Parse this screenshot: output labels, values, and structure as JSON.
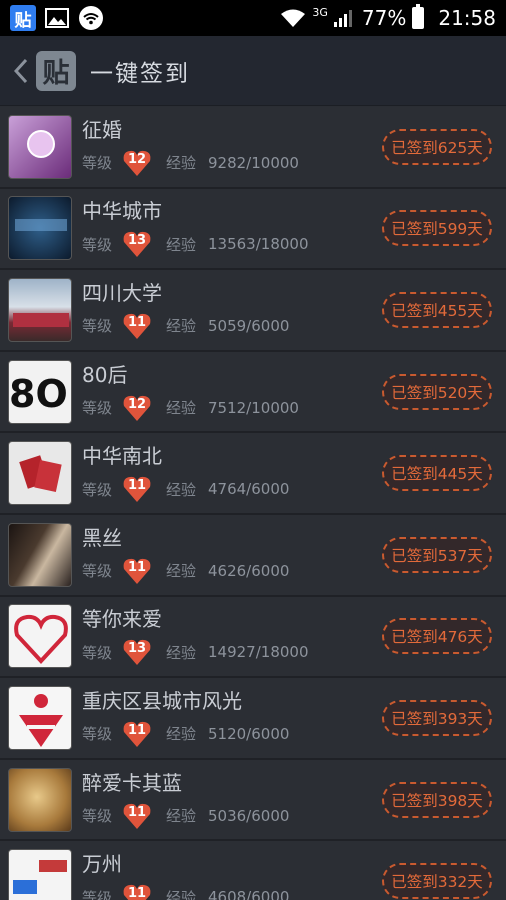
{
  "status_bar": {
    "network": "3G",
    "battery": "77%",
    "time": "21:58"
  },
  "header": {
    "logo_text": "贴",
    "title": "一键签到"
  },
  "labels": {
    "level": "等级",
    "exp": "经验"
  },
  "forums": [
    {
      "name": "征婚",
      "level": "12",
      "exp": "9282/10000",
      "signed": "已签到625天"
    },
    {
      "name": "中华城市",
      "level": "13",
      "exp": "13563/18000",
      "signed": "已签到599天"
    },
    {
      "name": "四川大学",
      "level": "11",
      "exp": "5059/6000",
      "signed": "已签到455天"
    },
    {
      "name": "80后",
      "level": "12",
      "exp": "7512/10000",
      "signed": "已签到520天"
    },
    {
      "name": "中华南北",
      "level": "11",
      "exp": "4764/6000",
      "signed": "已签到445天"
    },
    {
      "name": "黑丝",
      "level": "11",
      "exp": "4626/6000",
      "signed": "已签到537天"
    },
    {
      "name": "等你来爱",
      "level": "13",
      "exp": "14927/18000",
      "signed": "已签到476天"
    },
    {
      "name": "重庆区县城市风光",
      "level": "11",
      "exp": "5120/6000",
      "signed": "已签到393天"
    },
    {
      "name": "醉爱卡其蓝",
      "level": "11",
      "exp": "5036/6000",
      "signed": "已签到398天"
    },
    {
      "name": "万州",
      "level": "11",
      "exp": "4608/6000",
      "signed": "已签到332天"
    }
  ],
  "colors": {
    "heart": "#e0543b",
    "signed_text": "#e36a3a"
  }
}
